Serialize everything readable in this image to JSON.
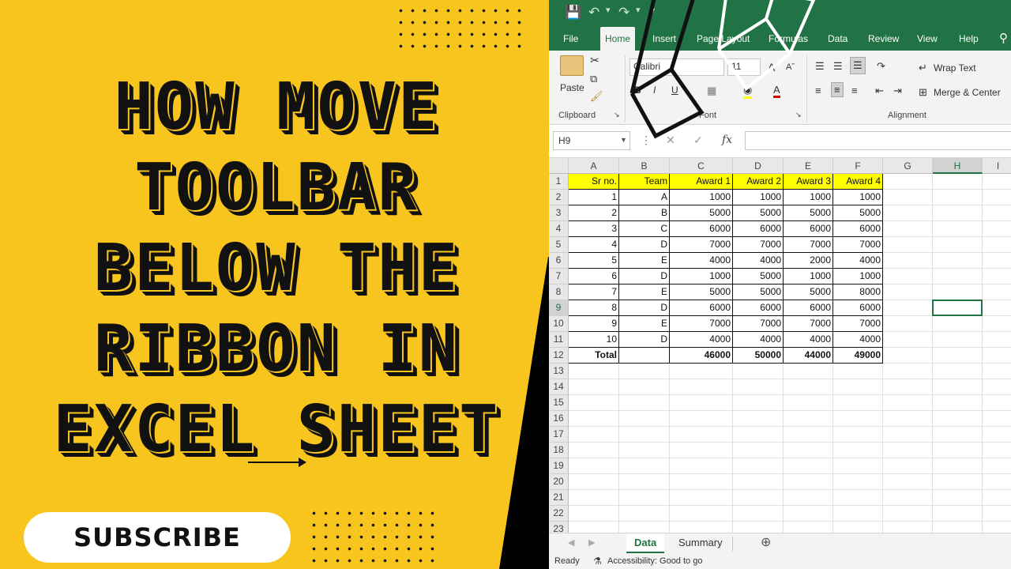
{
  "thumbnail": {
    "title_lines": [
      "HOW MOVE",
      "TOOLBAR",
      "BELOW THE",
      "RIBBON IN",
      "EXCEL SHEET"
    ],
    "subscribe_label": "SUBSCRIBE"
  },
  "excel": {
    "tabs": [
      "File",
      "Home",
      "Insert",
      "Page Layout",
      "Formulas",
      "Data",
      "Review",
      "View",
      "Help"
    ],
    "active_tab": "Home",
    "ribbon": {
      "paste_label": "Paste",
      "clipboard_label": "Clipboard",
      "font_name": "Calibri",
      "font_size": "11",
      "bold": "B",
      "italic": "I",
      "underline": "U",
      "font_group_label": "Font",
      "wrap_text": "Wrap Text",
      "merge_center": "Merge & Center",
      "alignment_label": "Alignment"
    },
    "name_box": "H9",
    "fx": "fx",
    "columns": [
      "A",
      "B",
      "C",
      "D",
      "E",
      "F",
      "G",
      "H",
      "I"
    ],
    "selected_column": "H",
    "selected_row": "9",
    "table": {
      "headers": [
        "Sr no.",
        "Team",
        "Award 1",
        "Award 2",
        "Award 3",
        "Award 4"
      ],
      "rows": [
        [
          "1",
          "A",
          "1000",
          "1000",
          "1000",
          "1000"
        ],
        [
          "2",
          "B",
          "5000",
          "5000",
          "5000",
          "5000"
        ],
        [
          "3",
          "C",
          "6000",
          "6000",
          "6000",
          "6000"
        ],
        [
          "4",
          "D",
          "7000",
          "7000",
          "7000",
          "7000"
        ],
        [
          "5",
          "E",
          "4000",
          "4000",
          "2000",
          "4000"
        ],
        [
          "6",
          "D",
          "1000",
          "5000",
          "1000",
          "1000"
        ],
        [
          "7",
          "E",
          "5000",
          "5000",
          "5000",
          "8000"
        ],
        [
          "8",
          "D",
          "6000",
          "6000",
          "6000",
          "6000"
        ],
        [
          "9",
          "E",
          "7000",
          "7000",
          "7000",
          "7000"
        ],
        [
          "10",
          "D",
          "4000",
          "4000",
          "4000",
          "4000"
        ]
      ],
      "total_row": [
        "Total",
        "",
        "46000",
        "50000",
        "44000",
        "49000"
      ]
    },
    "row_numbers": [
      "1",
      "2",
      "3",
      "4",
      "5",
      "6",
      "7",
      "8",
      "9",
      "10",
      "11",
      "12",
      "13",
      "14",
      "15",
      "16",
      "17",
      "18",
      "19",
      "20",
      "21",
      "22",
      "23"
    ],
    "sheets": [
      "Data",
      "Summary"
    ],
    "active_sheet": "Data",
    "status": {
      "ready": "Ready",
      "accessibility": "Accessibility: Good to go"
    },
    "colors": {
      "excel_green": "#217346",
      "header_fill": "#ffff00",
      "thumbnail_yellow": "#f7c51d"
    }
  }
}
